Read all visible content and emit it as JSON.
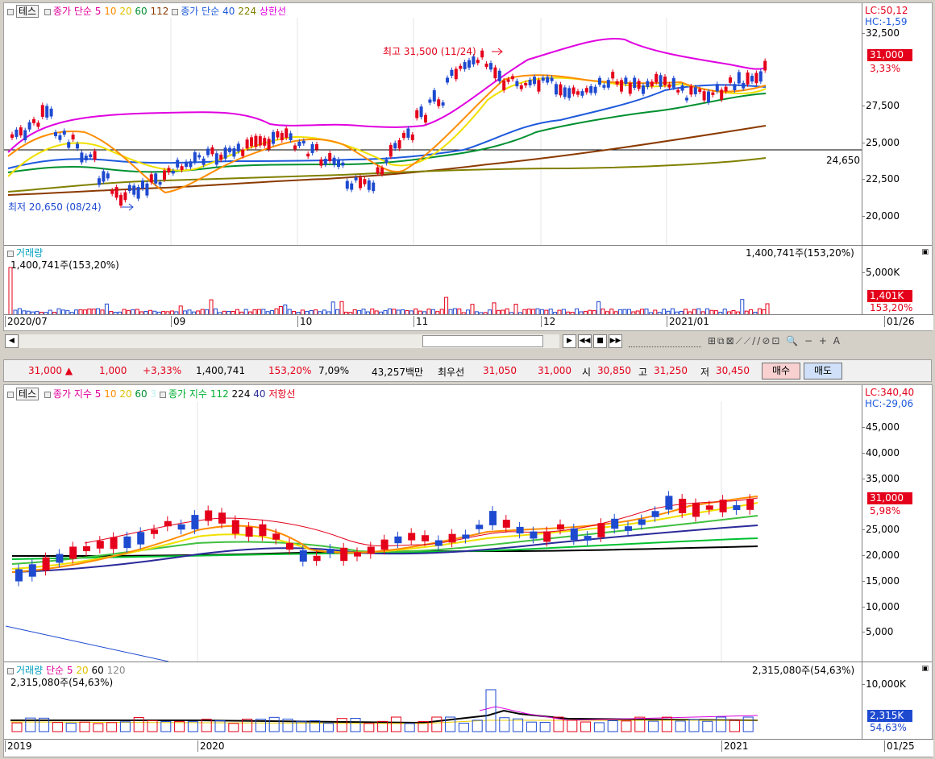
{
  "top_chart": {
    "legend": {
      "name": "테스",
      "ma_prefix": "종가 단순",
      "ma1": "5",
      "ma2": "10",
      "ma3": "20",
      "ma4": "60",
      "ma5": "112",
      "ma2_prefix": "종가 단순",
      "ma6": "40",
      "ma7": "224",
      "extra": "상한선"
    },
    "lc": "LC:50,12",
    "hc": "HC:-1,59",
    "y_ticks": [
      "32,500",
      "27,500",
      "25,000",
      "22,500",
      "20,000"
    ],
    "current_price": "31,000",
    "current_pct": "3,33%",
    "high_label": "최고 31,500 (11/24)",
    "low_label": "최저 20,650 (08/24)",
    "hline_label": "24,650",
    "volume": {
      "title": "거래량",
      "value": "1,400,741주(153,20%)",
      "right_value": "1,400,741주(153,20%)",
      "tick": "5,000K",
      "flag": "1,401K",
      "flag_pct": "153,20%"
    },
    "dates": [
      "2020/07",
      "09",
      "10",
      "11",
      "12",
      "2021/01"
    ],
    "end_date": "01/26"
  },
  "infobar": {
    "price": "31,000",
    "change": "1,000",
    "pct": "+3,33%",
    "volume": "1,400,741",
    "vol_pct": "153,20%",
    "turnover": "7,09%",
    "amount": "43,257백만",
    "best_ask_label": "최우선",
    "ask": "31,050",
    "bid": "31,000",
    "open_label": "시",
    "open": "30,850",
    "high_label": "고",
    "high": "31,250",
    "low_label": "저",
    "low": "30,450",
    "buy": "매수",
    "sell": "매도"
  },
  "bottom_chart": {
    "legend": {
      "name": "테스",
      "ma_prefix": "종가 지수",
      "ma1": "5",
      "ma2": "10",
      "ma3": "20",
      "ma4": "60",
      "ma5": "3",
      "ma2_prefix": "종가 지수",
      "ma6": "112",
      "ma7": "224",
      "ma8": "40",
      "extra": "저항선"
    },
    "lc": "LC:340,40",
    "hc": "HC:-29,06",
    "y_ticks": [
      "45,000",
      "40,000",
      "35,000",
      "30,000",
      "25,000",
      "20,000",
      "15,000",
      "10,000",
      "5,000"
    ],
    "current_price": "31,000",
    "current_pct": "5,98%",
    "volume": {
      "title": "거래량",
      "ma_prefix": "단순",
      "ma1": "5",
      "ma2": "20",
      "ma3": "60",
      "ma4": "120",
      "value": "2,315,080주(54,63%)",
      "right_value": "2,315,080주(54,63%)",
      "tick": "10,000K",
      "flag": "2,315K",
      "flag_pct": "54,63%"
    },
    "dates": [
      "2019",
      "2020",
      "2021"
    ],
    "end_date": "01/25"
  }
}
